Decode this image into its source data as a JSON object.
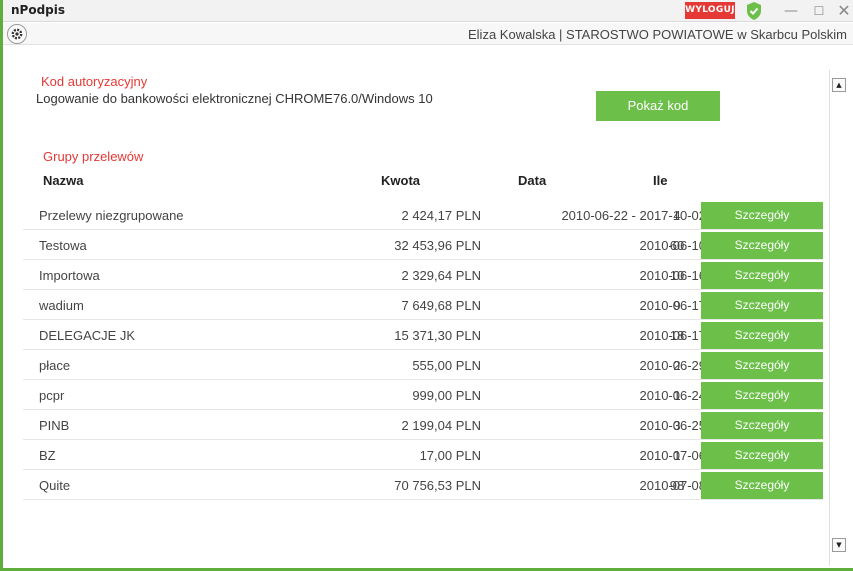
{
  "window": {
    "title": "nPodpis",
    "logout_label": "WYLOGUJ",
    "minimize_glyph": "—",
    "maximize_glyph": "☐",
    "close_glyph": "✕"
  },
  "header": {
    "user_info": "Eliza Kowalska  |  STAROSTWO POWIATOWE w Skarbcu Polskim"
  },
  "auth": {
    "title": "Kod autoryzacyjny",
    "description": "Logowanie do bankowości elektronicznej CHROME76.0/Windows 10",
    "show_code_label": "Pokaż kod"
  },
  "groups": {
    "title": "Grupy przelewów",
    "columns": {
      "name": "Nazwa",
      "amount": "Kwota",
      "date": "Data",
      "count": "Ile"
    },
    "details_label": "Szczegóły",
    "rows": [
      {
        "name": "Przelewy niezgrupowane",
        "amount": "2 424,17 PLN",
        "date": "2010-06-22 - 2017-10-02",
        "count": "4"
      },
      {
        "name": "Testowa",
        "amount": "32 453,96 PLN",
        "date": "2010-06-10",
        "count": "60"
      },
      {
        "name": "Importowa",
        "amount": "2 329,64 PLN",
        "date": "2010-06-16",
        "count": "10"
      },
      {
        "name": "wadium",
        "amount": "7 649,68 PLN",
        "date": "2010-06-17",
        "count": "9"
      },
      {
        "name": "DELEGACJE JK",
        "amount": "15 371,30 PLN",
        "date": "2010-06-17",
        "count": "18"
      },
      {
        "name": "płace",
        "amount": "555,00 PLN",
        "date": "2010-06-29",
        "count": "2"
      },
      {
        "name": "pcpr",
        "amount": "999,00 PLN",
        "date": "2010-06-24",
        "count": "1"
      },
      {
        "name": "PINB",
        "amount": "2 199,04 PLN",
        "date": "2010-06-25",
        "count": "3"
      },
      {
        "name": "BZ",
        "amount": "17,00 PLN",
        "date": "2010-07-06",
        "count": "1"
      },
      {
        "name": "Quite",
        "amount": "70 756,53 PLN",
        "date": "2010-07-08",
        "count": "98"
      }
    ]
  },
  "scrollbar": {
    "up_glyph": "▲",
    "down_glyph": "▼"
  },
  "colors": {
    "accent_green": "#6cc04a",
    "danger_red": "#e53935",
    "section_title_red": "#e53935"
  },
  "icons": {
    "settings": "gear-icon",
    "security": "shield-icon"
  }
}
